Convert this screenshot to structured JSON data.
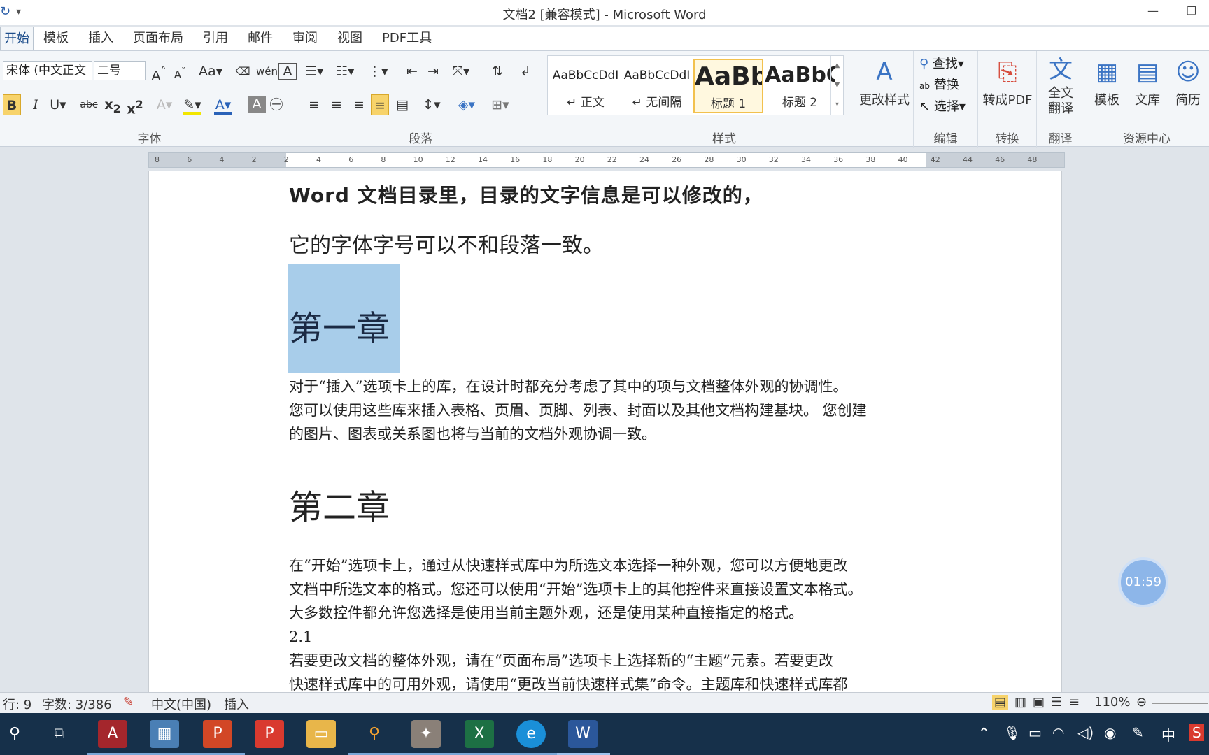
{
  "window": {
    "title": "文档2 [兼容模式] - Microsoft Word"
  },
  "tabs": [
    "开始",
    "模板",
    "插入",
    "页面布局",
    "引用",
    "邮件",
    "审阅",
    "视图",
    "PDF工具"
  ],
  "font": {
    "name": "宋体 (中文正文",
    "size": "二号",
    "group_label": "字体"
  },
  "paragraph": {
    "group_label": "段落"
  },
  "styles": {
    "group_label": "样式",
    "items": [
      {
        "preview": "AaBbCcDdI",
        "name": "↵ 正文"
      },
      {
        "preview": "AaBbCcDdI",
        "name": "↵ 无间隔"
      },
      {
        "preview": "AaBb",
        "name": "标题 1"
      },
      {
        "preview": "AaBbC",
        "name": "标题 2"
      }
    ],
    "change": "更改样式"
  },
  "editing": {
    "group_label": "编辑",
    "find": "查找",
    "replace": "替换",
    "select": "选择"
  },
  "convert": {
    "group_label": "转换",
    "label": "转成PDF"
  },
  "translate": {
    "group_label": "翻译",
    "label": "全文\n翻译"
  },
  "resources": {
    "group_label": "资源中心",
    "template": "模板",
    "library": "文库",
    "resume": "简历"
  },
  "ruler_numbers": [
    "8",
    "6",
    "4",
    "2",
    "2",
    "4",
    "6",
    "8",
    "10",
    "12",
    "14",
    "16",
    "18",
    "20",
    "22",
    "24",
    "26",
    "28",
    "30",
    "32",
    "34",
    "36",
    "38",
    "40",
    "42",
    "44",
    "46",
    "48"
  ],
  "document": {
    "line1": "Word 文档目录里，目录的文字信息是可以修改的，",
    "line2": "它的字体字号可以不和段落一致。",
    "heading1": "第一章",
    "para1": [
      "对于“插入”选项卡上的库，在设计时都充分考虑了其中的项与文档整体外观的协调性。",
      "您可以使用这些库来插入表格、页眉、页脚、列表、封面以及其他文档构建基块。 您创建",
      "的图片、图表或关系图也将与当前的文档外观协调一致。"
    ],
    "heading2": "第二章",
    "para2": [
      "在“开始”选项卡上，通过从快速样式库中为所选文本选择一种外观，您可以方便地更改",
      "文档中所选文本的格式。您还可以使用“开始”选项卡上的其他控件来直接设置文本格式。",
      "大多数控件都允许您选择是使用当前主题外观，还是使用某种直接指定的格式。"
    ],
    "sub": "2.1",
    "para3": [
      "若要更改文档的整体外观，请在“页面布局”选项卡上选择新的“主题”元素。若要更改",
      "快速样式库中的可用外观，请使用“更改当前快速样式集”命令。主题库和快速样式库都"
    ]
  },
  "timer": "01:59",
  "status": {
    "line": "行: 9",
    "words": "字数: 3/386",
    "lang": "中文(中国)",
    "mode": "插入",
    "zoom": "110%"
  },
  "tray": {
    "ime": "中"
  }
}
